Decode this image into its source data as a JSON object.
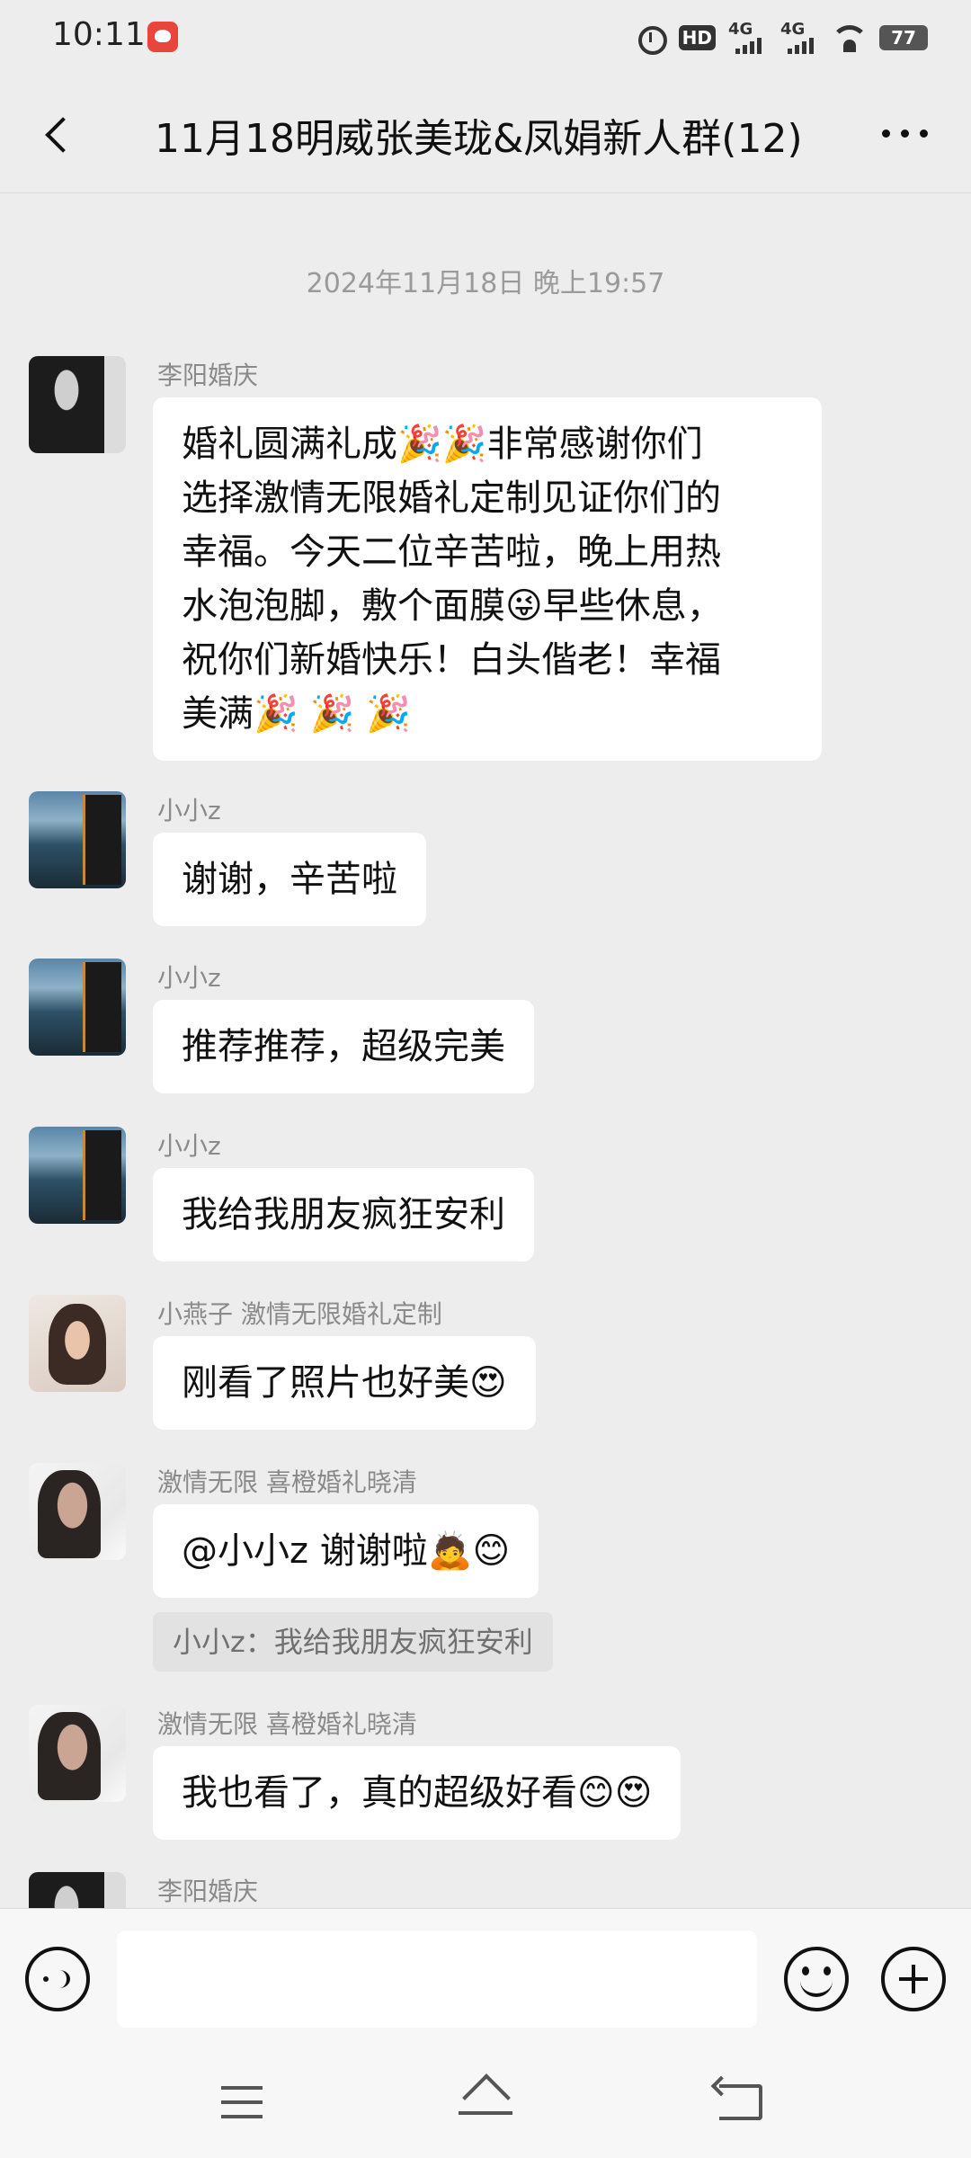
{
  "status_bar": {
    "time": "10:11",
    "hd_label": "HD",
    "signal1_label": "4G",
    "signal2_label": "4G",
    "battery": "77"
  },
  "header": {
    "title": "11月18明威张美珑&凤娟新人群(12)"
  },
  "chat": {
    "timestamp": "2024年11月18日 晚上19:57",
    "messages": [
      {
        "sender": "李阳婚庆",
        "lines": [
          "婚礼圆满礼成🎉🎉非常感谢你们",
          "选择激情无限婚礼定制见证你们的",
          "幸福。今天二位辛苦啦，晚上用热",
          "水泡泡脚，敷个面膜😜早些休息，",
          "祝你们新婚快乐！白头偕老！幸福",
          "美满🎉 🎉 🎉"
        ]
      },
      {
        "sender": "小小z",
        "text": "谢谢，辛苦啦"
      },
      {
        "sender": "小小z",
        "text": "推荐推荐，超级完美"
      },
      {
        "sender": "小小z",
        "text": "我给我朋友疯狂安利"
      },
      {
        "sender": "小燕子  激情无限婚礼定制",
        "text": "刚看了照片也好美😍"
      },
      {
        "sender": "激情无限  喜橙婚礼晓清",
        "text": "@小小z 谢谢啦🙇😊",
        "quote": "小小z：我给我朋友疯狂安利"
      },
      {
        "sender": "激情无限  喜橙婚礼晓清",
        "text": "我也看了，真的超级好看😊😍"
      },
      {
        "sender": "李阳婚庆"
      }
    ]
  },
  "input_bar": {
    "placeholder": ""
  },
  "icons": {
    "back": "back-arrow-icon",
    "more": "more-dots-icon",
    "voice": "voice-icon",
    "emoji": "emoji-icon",
    "plus": "plus-icon"
  }
}
